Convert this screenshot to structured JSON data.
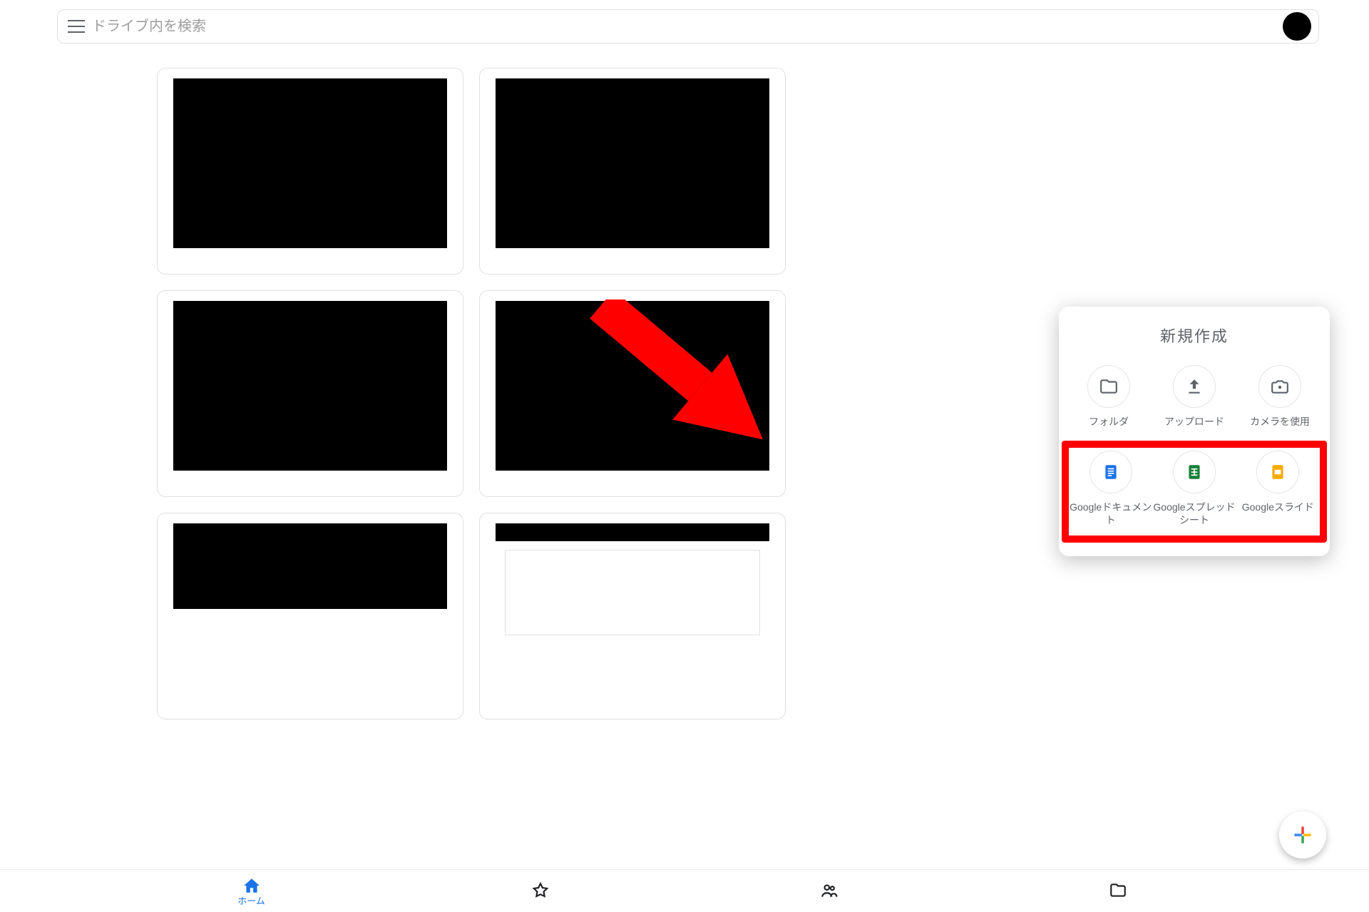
{
  "search": {
    "placeholder": "ドライブ内を検索"
  },
  "create_panel": {
    "title": "新規作成",
    "row1": [
      {
        "key": "folder",
        "label": "フォルダ"
      },
      {
        "key": "upload",
        "label": "アップロード"
      },
      {
        "key": "camera",
        "label": "カメラを使用"
      }
    ],
    "row2": [
      {
        "key": "docs",
        "label": "Googleドキュメント"
      },
      {
        "key": "sheets",
        "label": "Googleスプレッドシート"
      },
      {
        "key": "slides",
        "label": "Googleスライド"
      }
    ]
  },
  "bottom_nav": {
    "items": [
      {
        "key": "home",
        "label": "ホーム",
        "active": true
      },
      {
        "key": "starred",
        "label": ""
      },
      {
        "key": "shared",
        "label": ""
      },
      {
        "key": "files",
        "label": ""
      }
    ]
  },
  "colors": {
    "accent_blue": "#1a73e8",
    "accent_green": "#188038",
    "accent_yellow": "#f9ab00",
    "annotation_red": "#ff0000"
  }
}
